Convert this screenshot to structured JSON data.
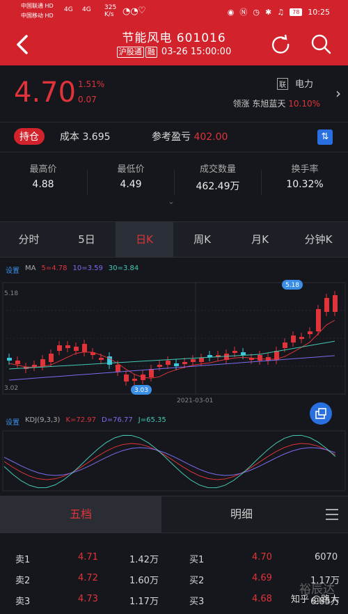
{
  "status": {
    "carrier1": "中国联通 HD",
    "carrier2": "中国移动 HD",
    "signal": "4G",
    "speed": "325",
    "speed_unit": "K/s",
    "battery": "78",
    "time": "10:25"
  },
  "header": {
    "title": "节能风电 601016",
    "tag1": "沪股通",
    "tag2": "融",
    "datetime": "03-26 15:00:00"
  },
  "quote": {
    "price": "4.70",
    "pct": "1.51%",
    "change": "0.07",
    "lianxi": "联",
    "industry": "电力",
    "leader_label": "领涨",
    "leader_name": "东旭蓝天",
    "leader_pct": "10.10%"
  },
  "holding": {
    "btn": "持仓",
    "cost_label": "成本",
    "cost": "3.695",
    "pnl_label": "参考盈亏",
    "pnl": "402.00"
  },
  "stats": [
    {
      "label": "最高价",
      "value": "4.88",
      "color": "#e0343a"
    },
    {
      "label": "最低价",
      "value": "4.49",
      "color": "#2fbf52"
    },
    {
      "label": "成交数量",
      "value": "462.49万",
      "color": "#eeeeee"
    },
    {
      "label": "换手率",
      "value": "10.32%",
      "color": "#eeeeee"
    }
  ],
  "tabs": [
    "分时",
    "5日",
    "日K",
    "周K",
    "月K",
    "分钟K"
  ],
  "active_tab": 2,
  "ma_legend": {
    "settings": "设置",
    "ma": "MA",
    "ma5": "5=4.78",
    "ma10": "10=3.59",
    "ma30": "30=3.84"
  },
  "chart_labels": {
    "top": "5.18",
    "bottom": "3.02",
    "high_mark": "5.18",
    "low_mark": "3.03",
    "date": "2021-03-01"
  },
  "kdj_legend": {
    "settings": "设置",
    "name": "KDJ(9,3,3)",
    "k": "K=72.97",
    "d": "D=76.77",
    "j": "J=65.35"
  },
  "orderbook_tabs": {
    "five": "五档",
    "detail": "明细"
  },
  "orderbook": {
    "sells": [
      {
        "label": "卖1",
        "price": "4.71",
        "vol": "1.42万"
      },
      {
        "label": "卖2",
        "price": "4.72",
        "vol": "1.60万"
      },
      {
        "label": "卖3",
        "price": "4.73",
        "vol": "1.17万"
      }
    ],
    "buys": [
      {
        "label": "买1",
        "price": "4.70",
        "vol": "6070"
      },
      {
        "label": "买2",
        "price": "4.69",
        "vol": "1.17万"
      },
      {
        "label": "买3",
        "price": "4.68",
        "vol": "6.85万"
      }
    ]
  },
  "watermark": "知乎 @路人",
  "watermark2": "裕辰达",
  "colors": {
    "up": "#e0343a",
    "down": "#2fbf52",
    "accent": "#d2232c",
    "blue": "#2a6fe0"
  }
}
